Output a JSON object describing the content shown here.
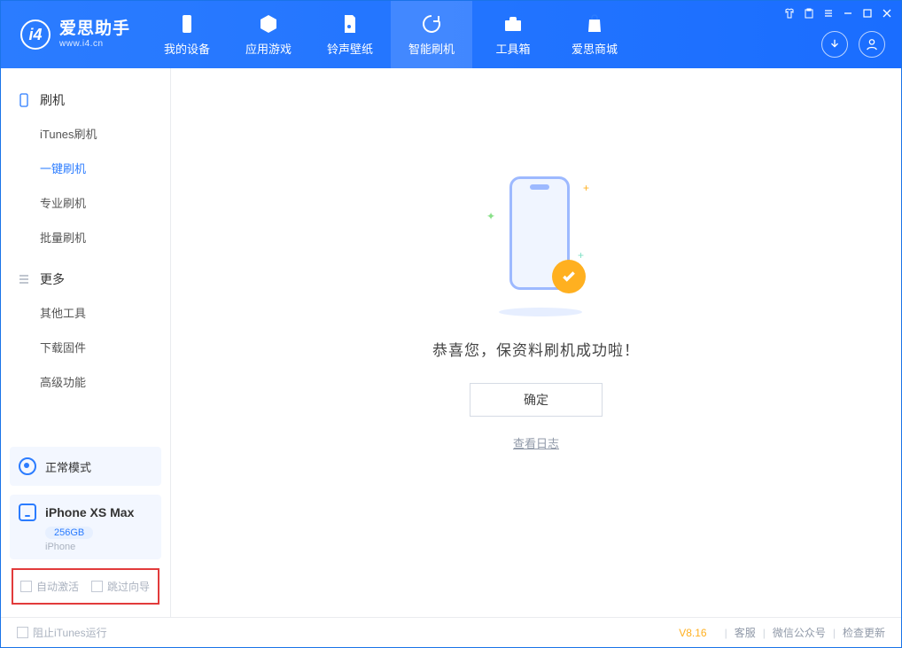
{
  "header": {
    "logo_title": "爱思助手",
    "logo_sub": "www.i4.cn",
    "nav": [
      {
        "label": "我的设备"
      },
      {
        "label": "应用游戏"
      },
      {
        "label": "铃声壁纸"
      },
      {
        "label": "智能刷机"
      },
      {
        "label": "工具箱"
      },
      {
        "label": "爱思商城"
      }
    ]
  },
  "sidebar": {
    "section_flash": "刷机",
    "flash_items": [
      {
        "label": "iTunes刷机"
      },
      {
        "label": "一键刷机"
      },
      {
        "label": "专业刷机"
      },
      {
        "label": "批量刷机"
      }
    ],
    "section_more": "更多",
    "more_items": [
      {
        "label": "其他工具"
      },
      {
        "label": "下载固件"
      },
      {
        "label": "高级功能"
      }
    ],
    "mode_label": "正常模式",
    "device": {
      "name": "iPhone XS Max",
      "capacity": "256GB",
      "type": "iPhone"
    },
    "option_auto_activate": "自动激活",
    "option_skip_wizard": "跳过向导"
  },
  "main": {
    "success_message": "恭喜您，保资料刷机成功啦！",
    "confirm_button": "确定",
    "log_link": "查看日志"
  },
  "footer": {
    "block_itunes": "阻止iTunes运行",
    "version": "V8.16",
    "link_support": "客服",
    "link_wechat": "微信公众号",
    "link_update": "检查更新"
  }
}
